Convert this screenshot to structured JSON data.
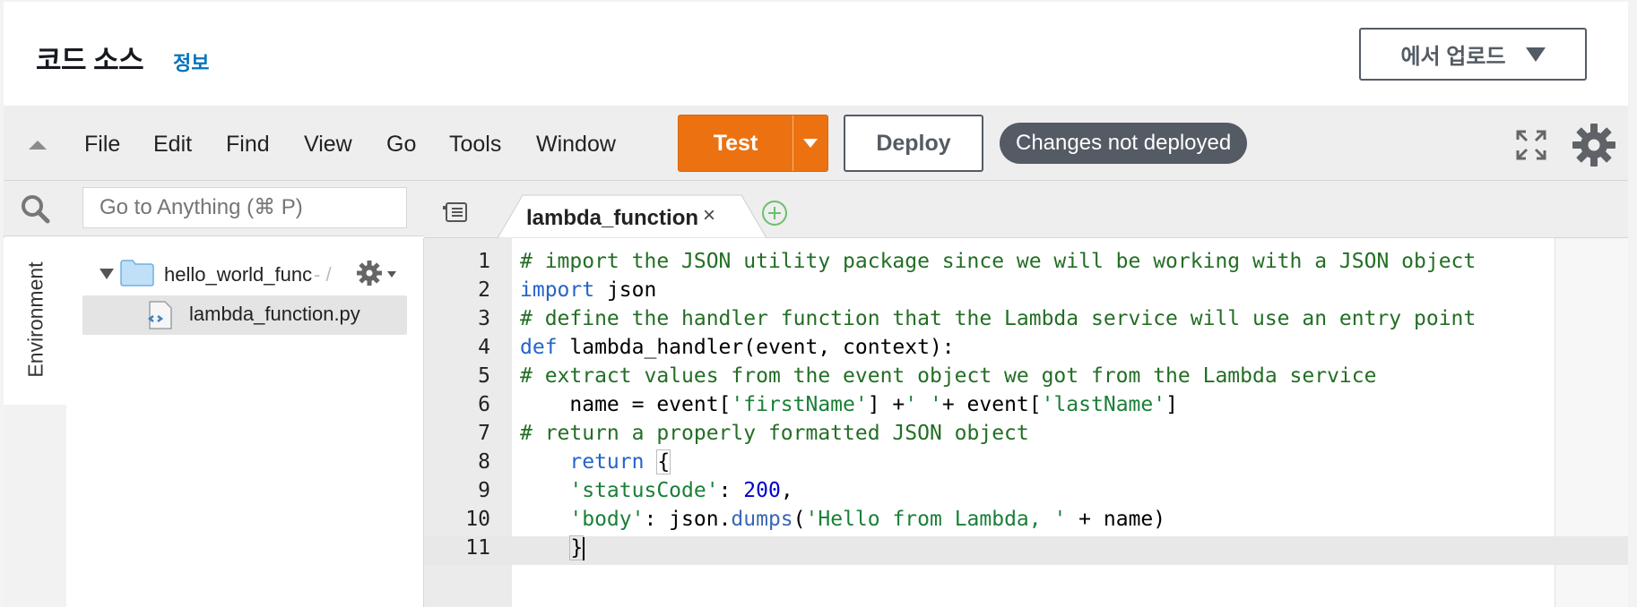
{
  "header": {
    "title": "코드 소스",
    "info_link": "정보",
    "upload_button": "에서 업로드"
  },
  "menubar": {
    "items": [
      "File",
      "Edit",
      "Find",
      "View",
      "Go",
      "Tools",
      "Window"
    ],
    "test_label": "Test",
    "deploy_label": "Deploy",
    "status_text": "Changes not deployed"
  },
  "sidebar": {
    "env_label": "Environment",
    "search_placeholder": "Go to Anything (⌘ P)",
    "folder_name": "hello_world_func",
    "folder_suffix": "- /",
    "file_name": "lambda_function.py"
  },
  "editor": {
    "tab_label": "lambda_function",
    "tab_close": "×",
    "line_numbers": [
      "1",
      "2",
      "3",
      "4",
      "5",
      "6",
      "7",
      "8",
      "9",
      "10",
      "11"
    ],
    "lines": {
      "l1_comment": "# import the JSON utility package since we will be working with a JSON object",
      "l2_kw": "import",
      "l2_rest": " json",
      "l3_comment": "# define the handler function that the Lambda service will use an entry point",
      "l4_kw": "def",
      "l4_rest": " lambda_handler(event, context):",
      "l5_comment": "# extract values from the event object we got from the Lambda service",
      "l6_a": "    name = event[",
      "l6_s1": "'firstName'",
      "l6_b": "] +",
      "l6_s2": "' '",
      "l6_c": "+ event[",
      "l6_s3": "'lastName'",
      "l6_d": "]",
      "l7_comment": "# return a properly formatted JSON object",
      "l8_indent": "    ",
      "l8_kw": "return",
      "l8_sp": " ",
      "l8_brace": "{",
      "l9_indent": "    ",
      "l9_str": "'statusCode'",
      "l9_colon": ": ",
      "l9_num": "200",
      "l9_comma": ",",
      "l10_indent": "    ",
      "l10_str": "'body'",
      "l10_a": ": json.",
      "l10_fn": "dumps",
      "l10_b": "(",
      "l10_s": "'Hello from Lambda, '",
      "l10_c": " + name)",
      "l11_indent": "    ",
      "l11_brace": "}"
    }
  },
  "colors": {
    "accent_orange": "#ec7211",
    "status_pill": "#545b64",
    "link_blue": "#0073bb",
    "comment_green": "#236e24"
  }
}
